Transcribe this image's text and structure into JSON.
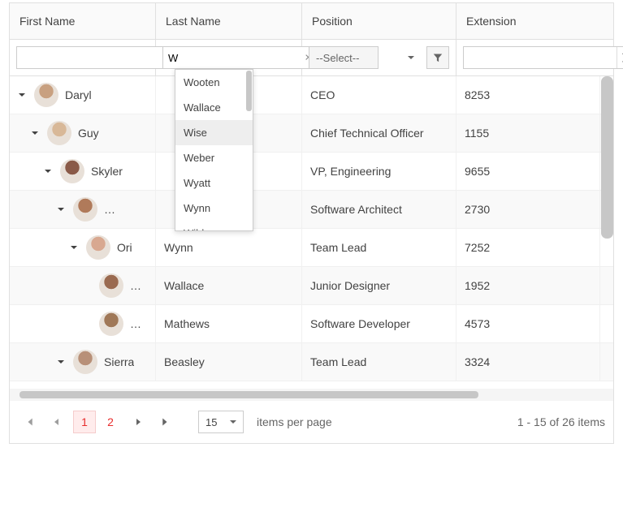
{
  "columns": {
    "first": "First Name",
    "last": "Last Name",
    "position": "Position",
    "ext": "Extension"
  },
  "filters": {
    "firstName": "",
    "lastName": "W",
    "positionPlaceholder": "--Select--",
    "extension": ""
  },
  "autocomplete": [
    "Wooten",
    "Wallace",
    "Wise",
    "Weber",
    "Wyatt",
    "Wynn",
    "Wilder"
  ],
  "rows": [
    {
      "indent": 0,
      "caret": true,
      "avatar": "#c8a080",
      "name": "Daryl",
      "last": "",
      "position": "CEO",
      "ext": "8253",
      "alt": false
    },
    {
      "indent": 1,
      "caret": true,
      "avatar": "#d8b898",
      "name": "Guy",
      "last": "",
      "position": "Chief Technical Officer",
      "ext": "1155",
      "alt": true
    },
    {
      "indent": 2,
      "caret": true,
      "avatar": "#8a5a48",
      "name": "Skyler",
      "last": "",
      "position": "VP, Engineering",
      "ext": "9655",
      "alt": false
    },
    {
      "indent": 3,
      "caret": true,
      "avatar": "#b07a5a",
      "name": "…",
      "last": "",
      "position": "Software Architect",
      "ext": "2730",
      "alt": true
    },
    {
      "indent": 4,
      "caret": true,
      "avatar": "#d8a890",
      "name": "Ori",
      "last": "Wynn",
      "position": "Team Lead",
      "ext": "7252",
      "alt": false
    },
    {
      "indent": 5,
      "caret": false,
      "avatar": "#9a6a50",
      "name": "…",
      "last": "Wallace",
      "position": "Junior Designer",
      "ext": "1952",
      "alt": true
    },
    {
      "indent": 5,
      "caret": false,
      "avatar": "#a07858",
      "name": "…",
      "last": "Mathews",
      "position": "Software Developer",
      "ext": "4573",
      "alt": false
    },
    {
      "indent": 3,
      "caret": true,
      "avatar": "#b89078",
      "name": "Sierra",
      "last": "Beasley",
      "position": "Team Lead",
      "ext": "3324",
      "alt": true
    }
  ],
  "pager": {
    "pages": [
      "1",
      "2"
    ],
    "activePage": "1",
    "pageSize": "15",
    "itemsLabel": "items per page",
    "info": "1 - 15 of 26 items"
  }
}
